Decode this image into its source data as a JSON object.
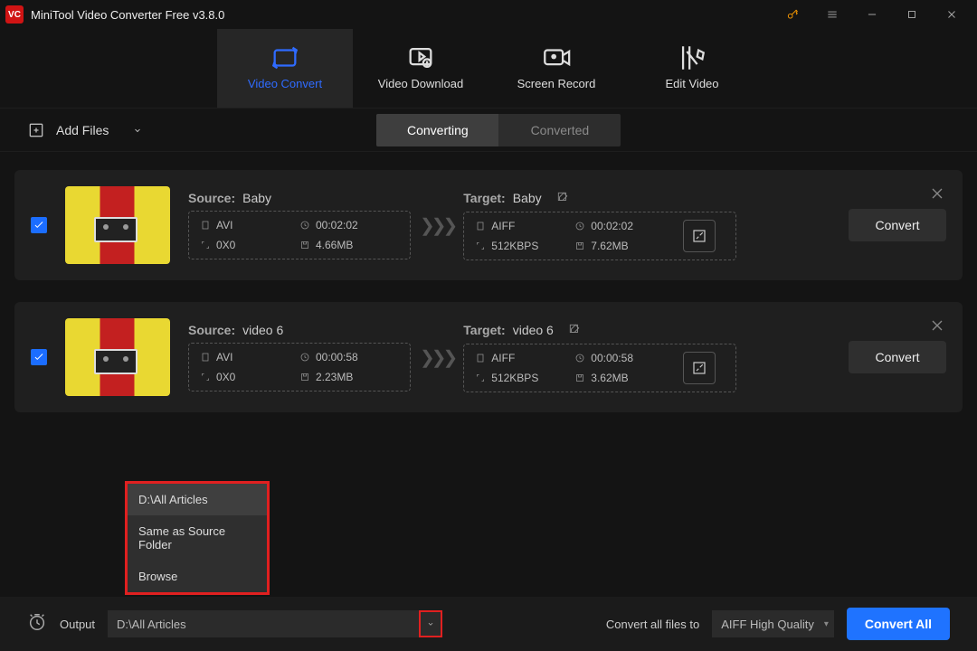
{
  "app_title": "MiniTool Video Converter Free v3.8.0",
  "tabs": {
    "convert": "Video Convert",
    "download": "Video Download",
    "record": "Screen Record",
    "edit": "Edit Video"
  },
  "toolbar": {
    "add_files": "Add Files",
    "seg_converting": "Converting",
    "seg_converted": "Converted"
  },
  "labels": {
    "source": "Source:",
    "target": "Target:"
  },
  "items": [
    {
      "source_name": "Baby",
      "src": {
        "format": "AVI",
        "duration": "00:02:02",
        "resolution": "0X0",
        "size": "4.66MB"
      },
      "target_name": "Baby",
      "tgt": {
        "format": "AIFF",
        "duration": "00:02:02",
        "bitrate": "512KBPS",
        "size": "7.62MB"
      },
      "convert": "Convert"
    },
    {
      "source_name": "video 6",
      "src": {
        "format": "AVI",
        "duration": "00:00:58",
        "resolution": "0X0",
        "size": "2.23MB"
      },
      "target_name": "video 6",
      "tgt": {
        "format": "AIFF",
        "duration": "00:00:58",
        "bitrate": "512KBPS",
        "size": "3.62MB"
      },
      "convert": "Convert"
    }
  ],
  "popup": {
    "opt1": "D:\\All Articles",
    "opt2": "Same as Source Folder",
    "opt3": "Browse"
  },
  "footer": {
    "output_label": "Output",
    "output_path": "D:\\All Articles",
    "convert_all_lbl": "Convert all files to",
    "profile": "AIFF High Quality",
    "convert_all_btn": "Convert All"
  },
  "colors": {
    "accent": "#1f73ff",
    "highlight": "#e02020"
  }
}
